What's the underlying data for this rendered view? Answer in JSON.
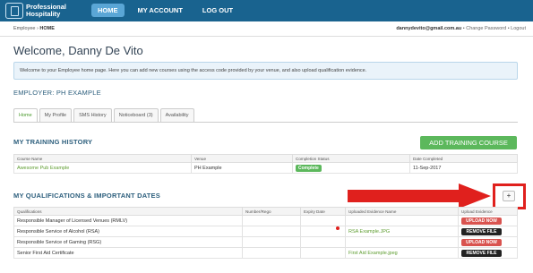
{
  "brand": {
    "line1": "Professional",
    "line2": "Hospitality"
  },
  "nav": {
    "items": [
      "HOME",
      "MY ACCOUNT",
      "LOG OUT"
    ],
    "active": "HOME"
  },
  "breadcrumb": {
    "prefix": "Employee",
    "separator": " › ",
    "current": "HOME"
  },
  "account": {
    "email": "dannydevito@gmail.com.au",
    "change_password": "Change Password",
    "logout": "Logout"
  },
  "welcome": {
    "prefix": "Welcome,",
    "name": "Danny De Vito"
  },
  "info_message": "Welcome to your Employee home page. Here you can add new courses using the access code provided by your venue, and also upload qualification evidence.",
  "employer": "EMPLOYER: PH EXAMPLE",
  "tabs": [
    "Home",
    "My Profile",
    "SMS History",
    "Noticeboard (3)",
    "Availability"
  ],
  "training": {
    "title": "MY TRAINING HISTORY",
    "add_button": "ADD TRAINING COURSE",
    "columns": [
      "Course Name",
      "Venue",
      "Completion Status",
      "Date Completed"
    ],
    "rows": [
      {
        "course": "Awesome Pub Example",
        "venue": "PH Example",
        "status": "Complete",
        "date": "11-Sep-2017"
      }
    ]
  },
  "qualifications": {
    "title": "MY QUALIFICATIONS & IMPORTANT DATES",
    "add_symbol": "+",
    "columns": [
      "Qualifications",
      "Number/Rego",
      "Expiry Date",
      "Uploaded Evidence Name",
      "Upload Evidence"
    ],
    "rows": [
      {
        "name": "Responsible Manager of Licensed Venues (RMLV)",
        "number": "",
        "expiry": "",
        "evidence": "",
        "action": "UPLOAD NOW"
      },
      {
        "name": "Responsible Service of Alcohol (RSA)",
        "number": "",
        "expiry": "",
        "evidence": "RSA Example.JPG",
        "action": "REMOVE FILE"
      },
      {
        "name": "Responsible Service of Gaming (RSG)",
        "number": "",
        "expiry": "",
        "evidence": "",
        "action": "UPLOAD NOW"
      },
      {
        "name": "Senior First Aid Certificate",
        "number": "",
        "expiry": "",
        "evidence": "First Aid Example.jpeg",
        "action": "REMOVE FILE"
      }
    ]
  },
  "colors": {
    "nav_bg": "#19638f",
    "accent_green": "#5cb85c",
    "danger_red": "#d9534f",
    "annotation_red": "#e0201d"
  }
}
